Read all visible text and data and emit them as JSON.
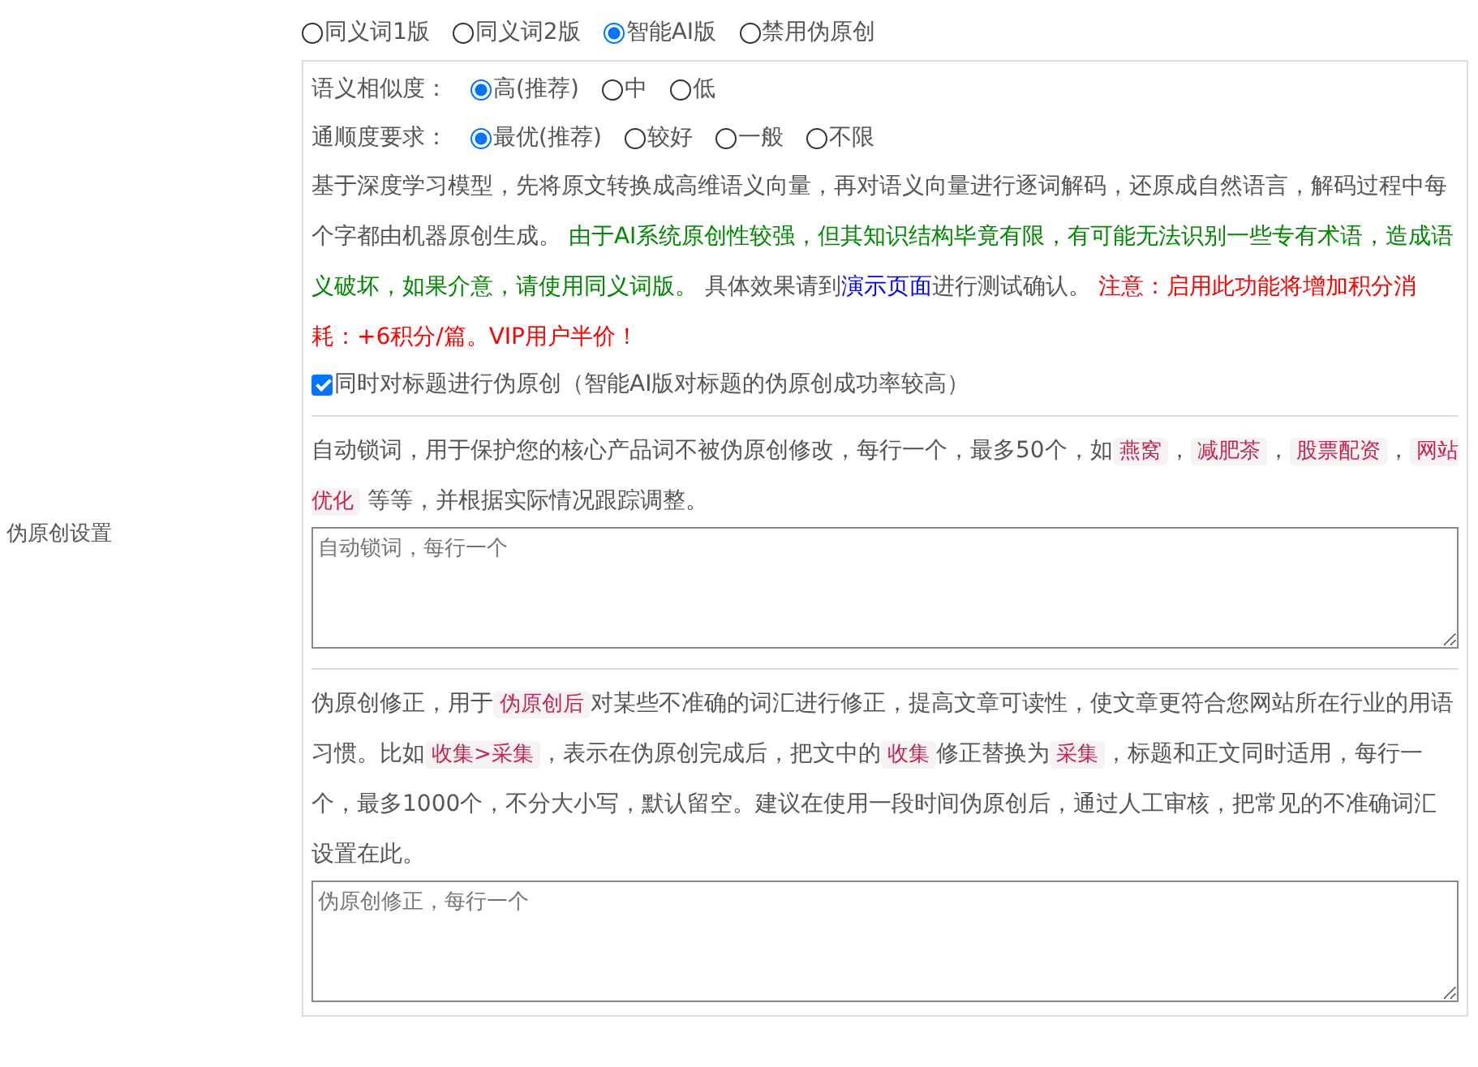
{
  "version_options": [
    {
      "label": "同义词1版",
      "selected": false
    },
    {
      "label": "同义词2版",
      "selected": false
    },
    {
      "label": "智能AI版",
      "selected": true
    },
    {
      "label": "禁用伪原创",
      "selected": false
    }
  ],
  "side_label": "伪原创设置",
  "settings_panel": {
    "similarity": {
      "label": "语义相似度：",
      "options": [
        {
          "label": "高(推荐)",
          "selected": true
        },
        {
          "label": "中",
          "selected": false
        },
        {
          "label": "低",
          "selected": false
        }
      ]
    },
    "fluency": {
      "label": "通顺度要求：",
      "options": [
        {
          "label": "最优(推荐)",
          "selected": true
        },
        {
          "label": "较好",
          "selected": false
        },
        {
          "label": "一般",
          "selected": false
        },
        {
          "label": "不限",
          "selected": false
        }
      ]
    },
    "description": [
      {
        "kind": "plain",
        "text": "基于深度学习模型，先将原文转换成高维语义向量，再对语义向量进行逐词解码，还原成自然语言，解码过程中每个字都由机器原创生成。 "
      },
      {
        "kind": "green",
        "text": "由于AI系统原创性较强，但其知识结构毕竟有限，有可能无法识别一些专有术语，造成语义破坏，如果介意，请使用同义词版。"
      },
      {
        "kind": "plain",
        "text": " 具体效果请到"
      },
      {
        "kind": "link",
        "text": "演示页面"
      },
      {
        "kind": "plain",
        "text": "进行测试确认。 "
      },
      {
        "kind": "red",
        "text": "注意：启用此功能将增加积分消耗：+6积分/篇。VIP用户半价！"
      }
    ],
    "title_checkbox": {
      "label": "同时对标题进行伪原创（智能AI版对标题的伪原创成功率较高）",
      "checked": true
    },
    "lock_words": {
      "description": [
        {
          "kind": "plain",
          "text": "自动锁词，用于保护您的核心产品词不被伪原创修改，每行一个，最多50个，如"
        },
        {
          "kind": "code",
          "text": "燕窝"
        },
        {
          "kind": "plain",
          "text": "，"
        },
        {
          "kind": "code",
          "text": "减肥茶"
        },
        {
          "kind": "plain",
          "text": "，"
        },
        {
          "kind": "code",
          "text": "股票配资"
        },
        {
          "kind": "plain",
          "text": "，"
        },
        {
          "kind": "code",
          "text": "网站优化"
        },
        {
          "kind": "plain",
          "text": " 等等，并根据实际情况跟踪调整。"
        }
      ],
      "textarea": {
        "placeholder": "自动锁词，每行一个"
      }
    },
    "correction": {
      "description": [
        {
          "kind": "plain",
          "text": "伪原创修正，用于"
        },
        {
          "kind": "code",
          "text": "伪原创后"
        },
        {
          "kind": "plain",
          "text": "对某些不准确的词汇进行修正，提高文章可读性，使文章更符合您网站所在行业的用语习惯。比如"
        },
        {
          "kind": "code",
          "text": "收集>采集"
        },
        {
          "kind": "plain",
          "text": "，表示在伪原创完成后，把文中的"
        },
        {
          "kind": "code",
          "text": "收集"
        },
        {
          "kind": "plain",
          "text": "修正替换为"
        },
        {
          "kind": "code",
          "text": "采集"
        },
        {
          "kind": "plain",
          "text": "，标题和正文同时适用，每行一个，最多1000个，不分大小写，默认留空。建议在使用一段时间伪原创后，通过人工审核，把常见的不准确词汇设置在此。"
        }
      ],
      "textarea": {
        "placeholder": "伪原创修正，每行一个"
      }
    }
  }
}
